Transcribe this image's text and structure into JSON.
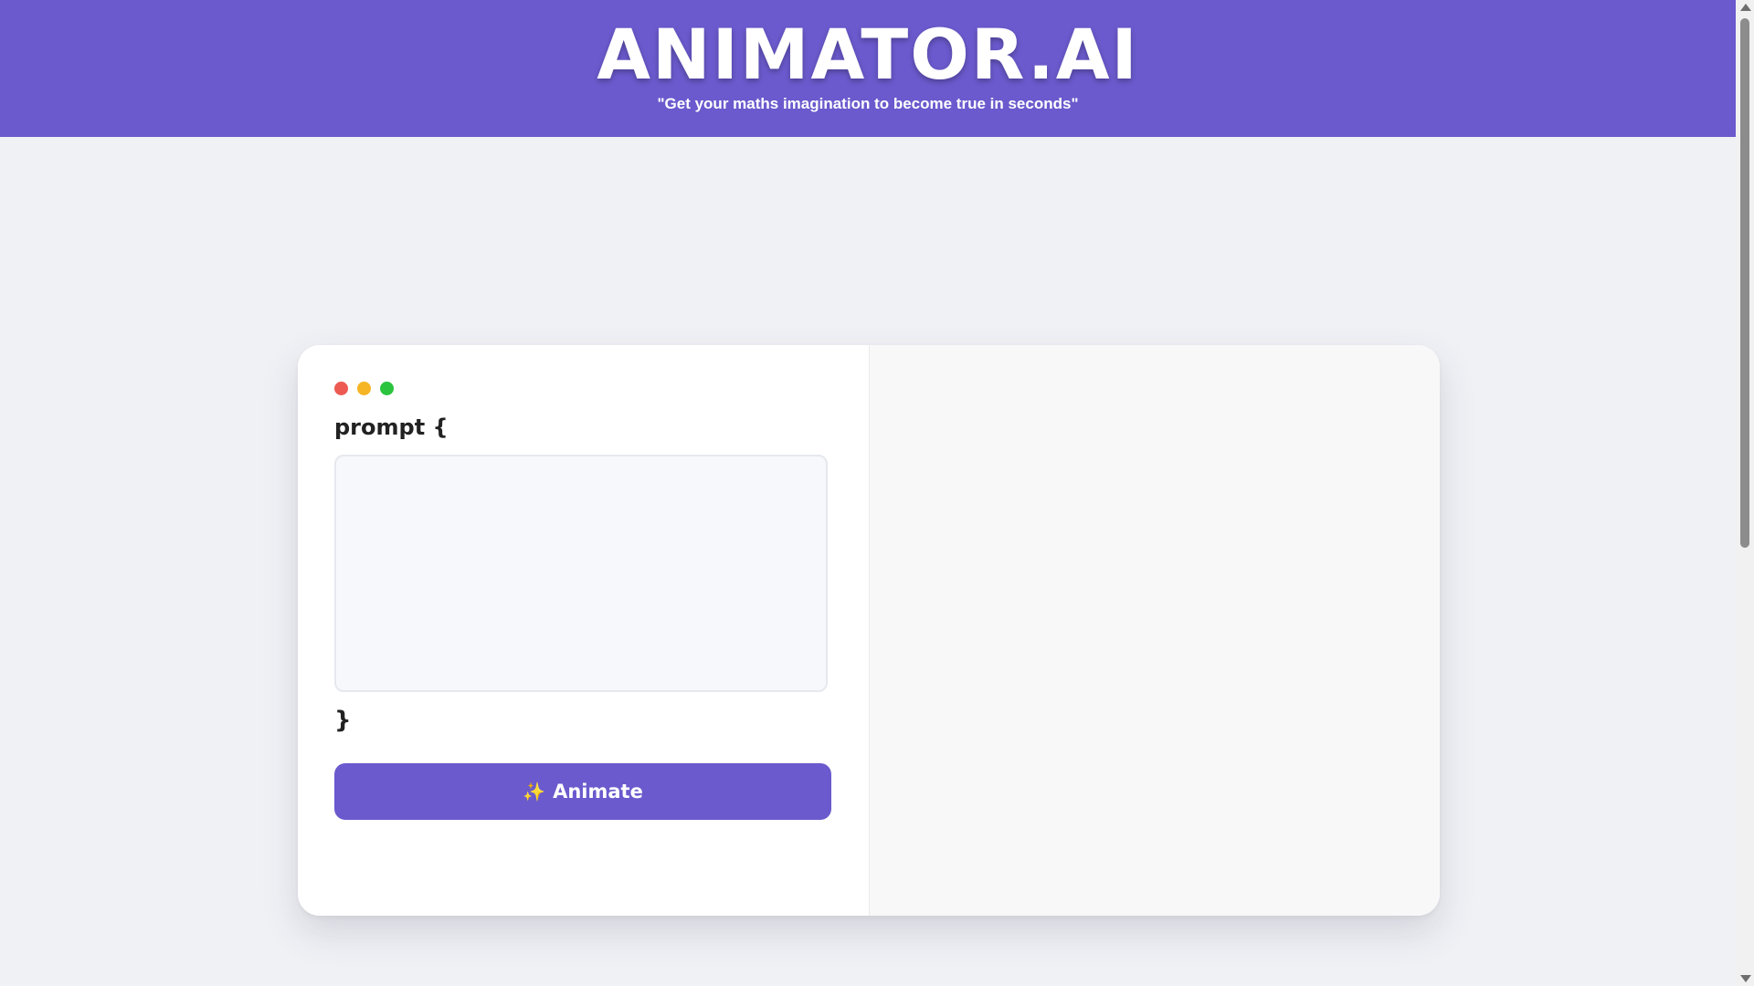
{
  "header": {
    "title": "ANIMATOR.AI",
    "tagline": "\"Get your maths imagination to become true in seconds\"",
    "background": "#6a5acd"
  },
  "editor": {
    "window_dots": [
      {
        "name": "close",
        "color": "#ed5a52"
      },
      {
        "name": "minimize",
        "color": "#f5b524"
      },
      {
        "name": "maximize",
        "color": "#2bc43f"
      }
    ],
    "prompt_open": "prompt {",
    "prompt_value": "",
    "prompt_placeholder": "",
    "prompt_close": "}",
    "animate_icon": "sparkles-icon",
    "animate_label": "Animate",
    "accent": "#6a5acd"
  },
  "preview": {
    "background": "#f8f8f8"
  },
  "page": {
    "background": "#f0f1f5"
  }
}
